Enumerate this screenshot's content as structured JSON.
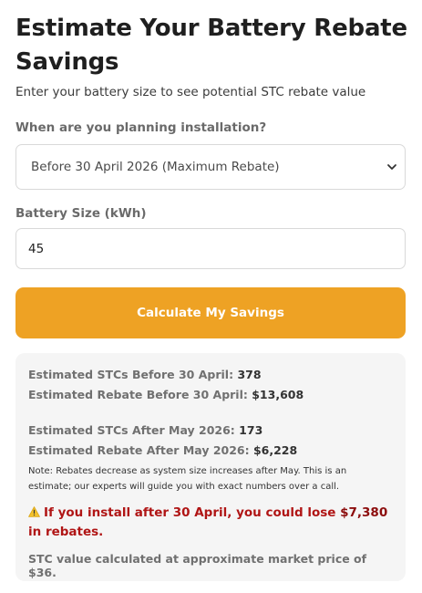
{
  "header": {
    "title_line1": "Estimate Your Battery Rebate",
    "title_line2": "Savings",
    "subtitle": "Enter your battery size to see potential STC rebate value"
  },
  "form": {
    "install_label": "When are you planning installation?",
    "install_selected": "Before 30 April 2026 (Maximum Rebate)",
    "battery_label": "Battery Size (kWh)",
    "battery_value": "45",
    "calculate_button": "Calculate My Savings"
  },
  "results": {
    "stcs_before_label": "Estimated STCs Before 30 April:",
    "stcs_before_value": "378",
    "rebate_before_label": "Estimated Rebate Before 30 April:",
    "rebate_before_value": "$13,608",
    "stcs_after_label": "Estimated STCs After May 2026:",
    "stcs_after_value": "173",
    "rebate_after_label": "Estimated Rebate After May 2026:",
    "rebate_after_value": "$6,228",
    "note": "Note: Rebates decrease as system size increases after May. This is an estimate; our experts will guide you with exact numbers over a call.",
    "warning_prefix": "If you install after 30 April, you could lose",
    "warning_amount": "$7,380",
    "warning_suffix": "in rebates.",
    "stc_price_note": "STC value calculated at approximate market price of $36."
  },
  "icons": {
    "warning": "warning-icon",
    "dropdown": "chevron-down-icon"
  },
  "colors": {
    "accent": "#eea224",
    "warning": "#b01515"
  }
}
